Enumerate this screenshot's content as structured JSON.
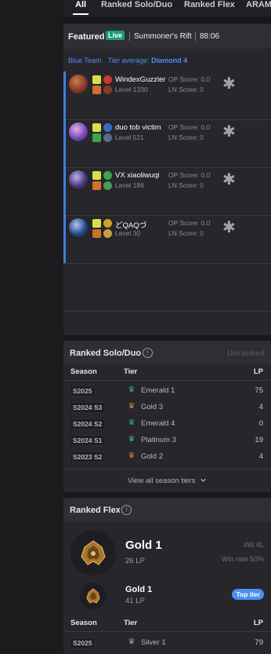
{
  "tabs": {
    "items": [
      "All",
      "Ranked Solo/Duo",
      "Ranked Flex",
      "ARAM"
    ],
    "active": "All"
  },
  "featured": {
    "title": "Featured",
    "live": "Live",
    "map": "Summoner's Rift",
    "timer": "88:06",
    "team": "Blue Team",
    "tier_avg_label": "Tier average:",
    "tier_avg_value": "Diamond 4",
    "players": [
      {
        "name": "WindexGuzzler",
        "level": "Level 1330",
        "op": "OP Score: 0.0",
        "ln": "LN Score: 0",
        "champ_color": "#8a3a2a"
      },
      {
        "name": "duo tob victim",
        "level": "Level 521",
        "op": "OP Score: 0.0",
        "ln": "LN Score: 0",
        "champ_color": "#7a4ab8"
      },
      {
        "name": "VX xiaoliwuqi",
        "level": "Level 186",
        "op": "OP Score: 0.0",
        "ln": "LN Score: 0",
        "champ_color": "#4a3a7a"
      },
      {
        "name": "どQAQづ",
        "level": "Level 30",
        "op": "OP Score: 0.0",
        "ln": "LN Score: 0",
        "champ_color": "#2a4a8a"
      }
    ]
  },
  "solo": {
    "title": "Ranked Solo/Duo",
    "status": "Unranked",
    "col_season": "Season",
    "col_tier": "Tier",
    "col_lp": "LP",
    "rows": [
      {
        "season": "S2025",
        "tier": "Emerald 1",
        "lp": "75",
        "color": "#2fb07a"
      },
      {
        "season": "S2024 S3",
        "tier": "Gold 3",
        "lp": "4",
        "color": "#c68a3a"
      },
      {
        "season": "S2024 S2",
        "tier": "Emerald 4",
        "lp": "0",
        "color": "#2fb07a"
      },
      {
        "season": "S2024 S1",
        "tier": "Platinum 3",
        "lp": "19",
        "color": "#4aa3b8"
      },
      {
        "season": "S2023 S2",
        "tier": "Gold 2",
        "lp": "4",
        "color": "#c68a3a"
      }
    ],
    "view_all": "View all season tiers"
  },
  "flex": {
    "title": "Ranked Flex",
    "tier": "Gold 1",
    "lp": "26 LP",
    "wl": "4W 4L",
    "winrate": "Win rate 50%",
    "peak_tier": "Gold 1",
    "peak_lp": "41 LP",
    "top_tier_badge": "Top tier",
    "col_season": "Season",
    "col_tier": "Tier",
    "col_lp": "LP",
    "rows": [
      {
        "season": "S2025",
        "tier": "Silver 1",
        "lp": "79",
        "color": "#8fa3ad"
      }
    ]
  },
  "icons": {
    "star": "star-icon",
    "info": "info-icon",
    "chevron": "chevron-down-icon"
  }
}
